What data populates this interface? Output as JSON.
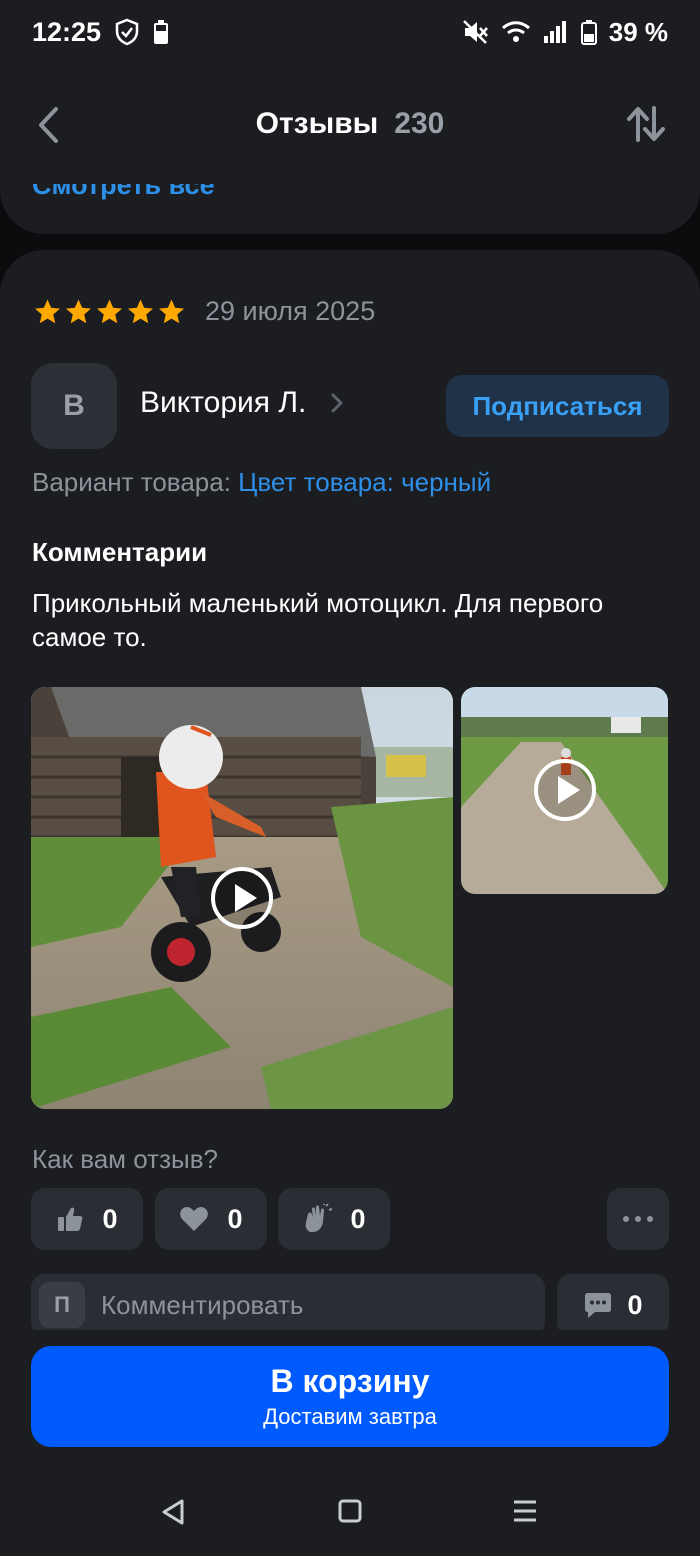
{
  "status_bar": {
    "time": "12:25",
    "battery": "39 %",
    "icons": [
      "shield-icon",
      "battery-small-icon",
      "mute-icon",
      "wifi-icon",
      "signal-icon",
      "battery-icon"
    ]
  },
  "header": {
    "title": "Отзывы",
    "count": "230",
    "see_all": "Смотреть все"
  },
  "review": {
    "rating": 5,
    "date": "29 июля 2025",
    "author_initial": "В",
    "author_name": "Виктория Л.",
    "subscribe_label": "Подписаться",
    "variant_label": "Вариант товара:",
    "variant_value": "Цвет товара: черный",
    "comments_heading": "Комментарии",
    "comment_text": "Прикольный маленький мотоцикл. Для первого самое то.",
    "media": [
      {
        "type": "video",
        "description": "child-on-motorcycle"
      },
      {
        "type": "video",
        "description": "rider-on-road"
      }
    ]
  },
  "feedback": {
    "question": "Как вам отзыв?",
    "reactions": [
      {
        "icon": "thumbs-up-icon",
        "count": "0"
      },
      {
        "icon": "heart-icon",
        "count": "0"
      },
      {
        "icon": "clap-icon",
        "count": "0"
      }
    ]
  },
  "comment_box": {
    "user_initial": "П",
    "placeholder": "Комментировать",
    "count": "0"
  },
  "cart": {
    "label": "В корзину",
    "sublabel": "Доставим завтра"
  },
  "colors": {
    "accent": "#005bff",
    "link": "#2d8fe8",
    "star": "#ffa800",
    "card": "#1b1d21"
  }
}
